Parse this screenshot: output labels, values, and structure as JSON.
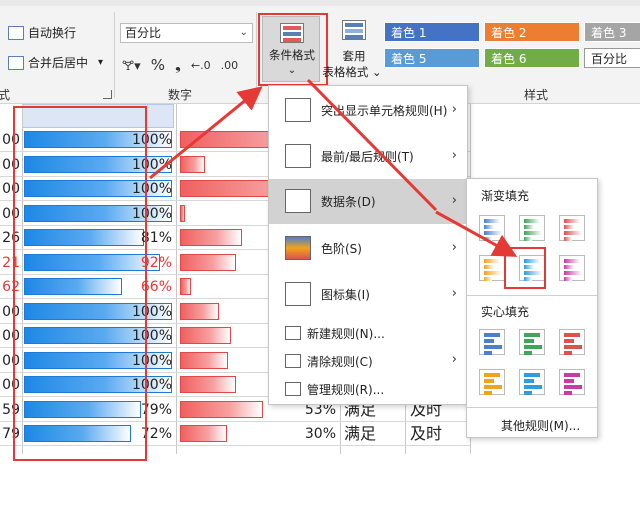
{
  "ribbon": {
    "auto_wrap": "自动换行",
    "merge_center": "合并后居中",
    "number_format": "百分比",
    "number_group": "数字",
    "alignment_group_tail": "式",
    "styles_group": "样式",
    "percent_symbol": "%",
    "comma_symbol": "❟",
    "cond_format_label": "条件格式",
    "table_format_line1": "套用",
    "table_format_line2": "表格格式",
    "styles": [
      {
        "label": "着色 1",
        "color": "#4472c4"
      },
      {
        "label": "着色 2",
        "color": "#ed7d31"
      },
      {
        "label": "着色 3",
        "color": "#a5a5a5"
      },
      {
        "label": "着色 5",
        "color": "#5b9bd5"
      },
      {
        "label": "着色 6",
        "color": "#70ad47"
      },
      {
        "label": "百分比",
        "color": "#ffffff"
      }
    ]
  },
  "menu": {
    "items": [
      {
        "label": "突出显示单元格规则(H)",
        "has_sub": true
      },
      {
        "label": "最前/最后规则(T)",
        "has_sub": true
      },
      {
        "label": "数据条(D)",
        "has_sub": true,
        "highlighted": true
      },
      {
        "label": "色阶(S)",
        "has_sub": true
      },
      {
        "label": "图标集(I)",
        "has_sub": true
      },
      {
        "label": "新建规则(N)...",
        "has_sub": false
      },
      {
        "label": "清除规则(C)",
        "has_sub": true
      },
      {
        "label": "管理规则(R)...",
        "has_sub": false
      }
    ]
  },
  "submenu": {
    "gradient_header": "渐变填充",
    "solid_header": "实心填充",
    "more_rules": "其他规则(M)...",
    "swatch_colors": [
      "#4a7fd1",
      "#3ca659",
      "#d9534f",
      "#f2a31b",
      "#2f9be0",
      "#c93aa2"
    ]
  },
  "sheet": {
    "rows": [
      {
        "a": "00",
        "b": "100%",
        "b_frac": 1.0,
        "c_frac": 1.0,
        "c": "",
        "d": "",
        "e": "",
        "a_red": false
      },
      {
        "a": "00",
        "b": "100%",
        "b_frac": 1.0,
        "c_frac": 0.16,
        "c": "",
        "d": "",
        "e": "",
        "a_red": false
      },
      {
        "a": "00",
        "b": "100%",
        "b_frac": 1.0,
        "c_frac": 1.0,
        "c": "",
        "d": "",
        "e": "",
        "a_red": false
      },
      {
        "a": "00",
        "b": "100%",
        "b_frac": 1.0,
        "c_frac": 0.03,
        "c": "",
        "d": "",
        "e": "",
        "a_red": false
      },
      {
        "a": "26",
        "b": "81%",
        "b_frac": 0.81,
        "c_frac": 0.4,
        "c": "",
        "d": "",
        "e": "",
        "a_red": false
      },
      {
        "a": "21",
        "b": "92%",
        "b_frac": 0.92,
        "c_frac": 0.36,
        "c": "",
        "d": "",
        "e": "",
        "a_red": true
      },
      {
        "a": "62",
        "b": "66%",
        "b_frac": 0.66,
        "c_frac": 0.07,
        "c": "",
        "d": "",
        "e": "",
        "a_red": true
      },
      {
        "a": "00",
        "b": "100%",
        "b_frac": 1.0,
        "c_frac": 0.25,
        "c": "",
        "d": "",
        "e": "",
        "a_red": false
      },
      {
        "a": "00",
        "b": "100%",
        "b_frac": 1.0,
        "c_frac": 0.33,
        "c": "",
        "d": "",
        "e": "",
        "a_red": false
      },
      {
        "a": "00",
        "b": "100%",
        "b_frac": 1.0,
        "c_frac": 0.31,
        "c": "",
        "d": "",
        "e": "",
        "a_red": false
      },
      {
        "a": "00",
        "b": "100%",
        "b_frac": 1.0,
        "c_frac": 0.36,
        "c": "",
        "d": "",
        "e": "",
        "a_red": false
      },
      {
        "a": "59",
        "b": "79%",
        "b_frac": 0.79,
        "c_frac": 0.53,
        "c": "53%",
        "d": "满足",
        "e": "及时",
        "a_red": false
      },
      {
        "a": "79",
        "b": "72%",
        "b_frac": 0.72,
        "c_frac": 0.3,
        "c": "30%",
        "d": "满足",
        "e": "及时",
        "a_red": false
      }
    ]
  }
}
